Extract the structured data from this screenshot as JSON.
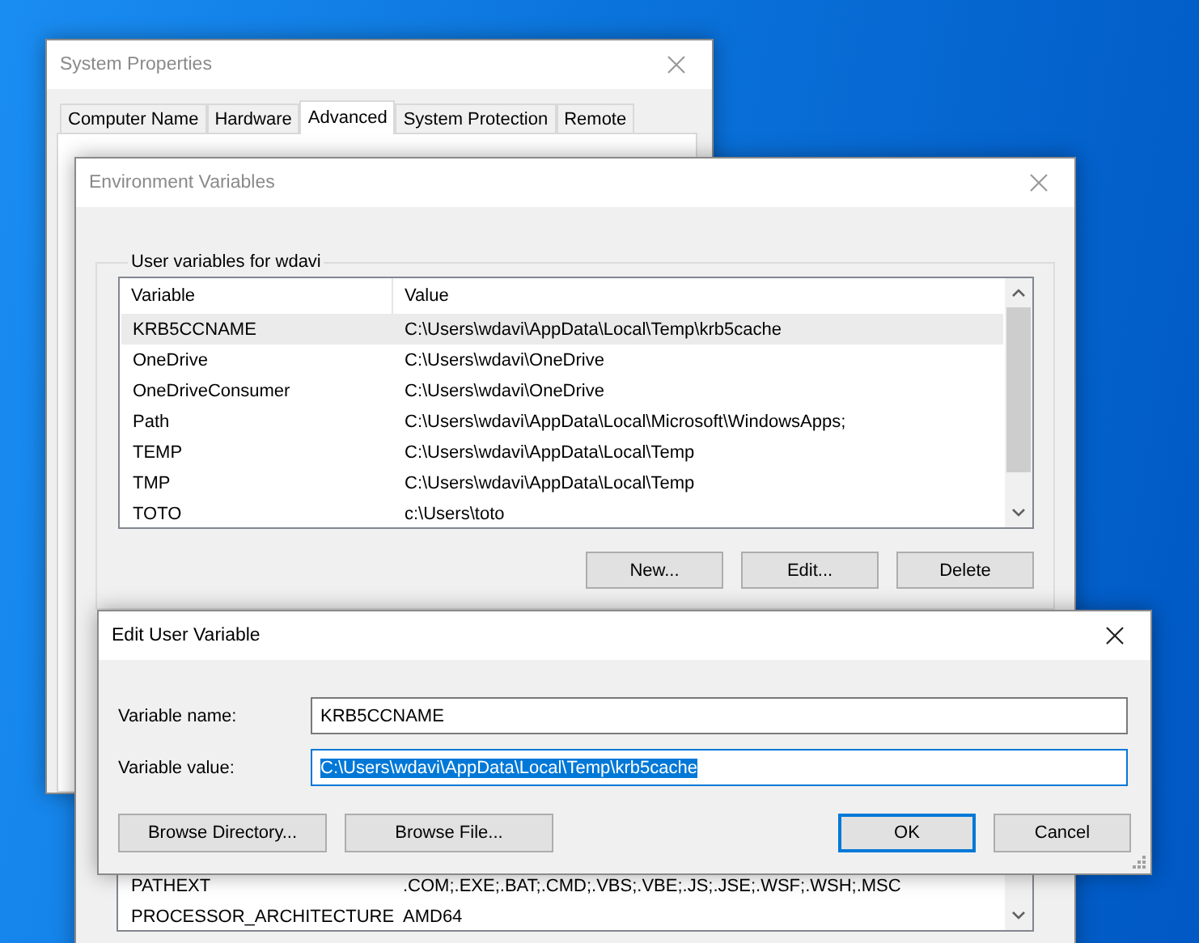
{
  "system_properties": {
    "title": "System Properties",
    "tabs": [
      {
        "label": "Computer Name",
        "selected": false
      },
      {
        "label": "Hardware",
        "selected": false
      },
      {
        "label": "Advanced",
        "selected": true
      },
      {
        "label": "System Protection",
        "selected": false
      },
      {
        "label": "Remote",
        "selected": false
      }
    ]
  },
  "environment_variables": {
    "title": "Environment Variables",
    "user_group": {
      "label": "User variables for wdavi",
      "columns": [
        "Variable",
        "Value"
      ],
      "rows": [
        {
          "variable": "KRB5CCNAME",
          "value": "C:\\Users\\wdavi\\AppData\\Local\\Temp\\krb5cache",
          "selected": true
        },
        {
          "variable": "OneDrive",
          "value": "C:\\Users\\wdavi\\OneDrive",
          "selected": false
        },
        {
          "variable": "OneDriveConsumer",
          "value": "C:\\Users\\wdavi\\OneDrive",
          "selected": false
        },
        {
          "variable": "Path",
          "value": "C:\\Users\\wdavi\\AppData\\Local\\Microsoft\\WindowsApps;",
          "selected": false
        },
        {
          "variable": "TEMP",
          "value": "C:\\Users\\wdavi\\AppData\\Local\\Temp",
          "selected": false
        },
        {
          "variable": "TMP",
          "value": "C:\\Users\\wdavi\\AppData\\Local\\Temp",
          "selected": false
        },
        {
          "variable": "TOTO",
          "value": "c:\\Users\\toto",
          "selected": false
        }
      ],
      "buttons": [
        "New...",
        "Edit...",
        "Delete"
      ]
    },
    "system_rows": [
      {
        "variable": "PATHEXT",
        "value": ".COM;.EXE;.BAT;.CMD;.VBS;.VBE;.JS;.JSE;.WSF;.WSH;.MSC"
      },
      {
        "variable": "PROCESSOR_ARCHITECTURE",
        "value": "AMD64"
      }
    ]
  },
  "edit_dialog": {
    "title": "Edit User Variable",
    "fields": [
      {
        "label": "Variable name:",
        "value": "KRB5CCNAME",
        "focused": false
      },
      {
        "label": "Variable value:",
        "value": "C:\\Users\\wdavi\\AppData\\Local\\Temp\\krb5cache",
        "focused": true
      }
    ],
    "left_buttons": [
      {
        "label": "Browse Directory...",
        "default": false
      },
      {
        "label": "Browse File...",
        "default": false
      }
    ],
    "right_buttons": [
      {
        "label": "OK",
        "default": true
      },
      {
        "label": "Cancel",
        "default": false
      }
    ]
  }
}
